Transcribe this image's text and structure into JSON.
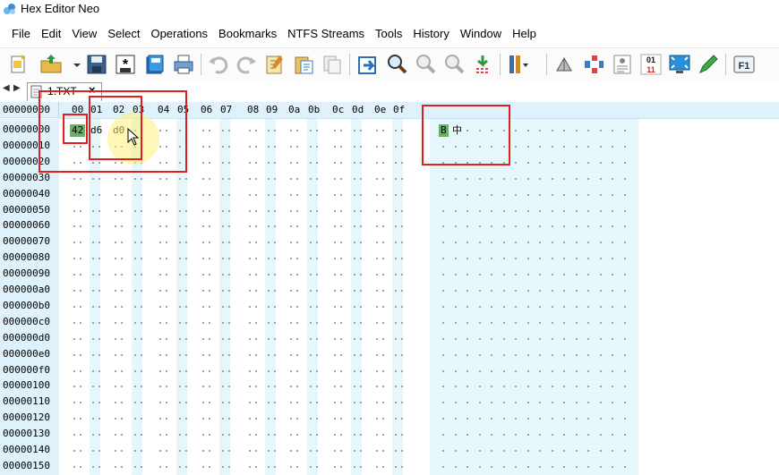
{
  "window": {
    "title": "Hex Editor Neo"
  },
  "menu": [
    "File",
    "Edit",
    "View",
    "Select",
    "Operations",
    "Bookmarks",
    "NTFS Streams",
    "Tools",
    "History",
    "Window",
    "Help"
  ],
  "toolbar": {
    "icons": [
      "new-file-icon",
      "open-file-icon",
      "dropdown-arrow-icon",
      "save-icon",
      "save-all-icon",
      "save-as-icon",
      "print-icon",
      "undo-icon",
      "redo-icon",
      "edit-icon",
      "paste-icon",
      "copy-icon",
      "goto-icon",
      "find-icon",
      "find-next-icon",
      "find-prev-icon",
      "replace-icon",
      "columns-icon",
      "compare-icon",
      "pattern-icon",
      "structure-icon",
      "binary-icon",
      "fullscreen-icon",
      "pen-icon",
      "help-f1-icon"
    ],
    "f1_label": "F1",
    "binary_label": "01\n11"
  },
  "tab": {
    "label": "1.TXT",
    "close": "×",
    "nav_left": "◀",
    "nav_right": "▶"
  },
  "header": {
    "offset_label": "00000000",
    "columns": [
      "00",
      "01",
      "02",
      "03",
      "04",
      "05",
      "06",
      "07",
      "08",
      "09",
      "0a",
      "0b",
      "0c",
      "0d",
      "0e",
      "0f"
    ]
  },
  "offsets": [
    "00000000",
    "00000010",
    "00000020",
    "00000030",
    "00000040",
    "00000050",
    "00000060",
    "00000070",
    "00000080",
    "00000090",
    "000000a0",
    "000000b0",
    "000000c0",
    "000000d0",
    "000000e0",
    "000000f0",
    "00000100",
    "00000110",
    "00000120",
    "00000130",
    "00000140",
    "00000150"
  ],
  "data_bytes": [
    "42",
    "d6",
    "d0"
  ],
  "text_chars": [
    "B",
    "中"
  ],
  "colors": {
    "header_bg": "#dff2fb",
    "selection": "#6aaf6a",
    "annotation": "#e02020"
  }
}
